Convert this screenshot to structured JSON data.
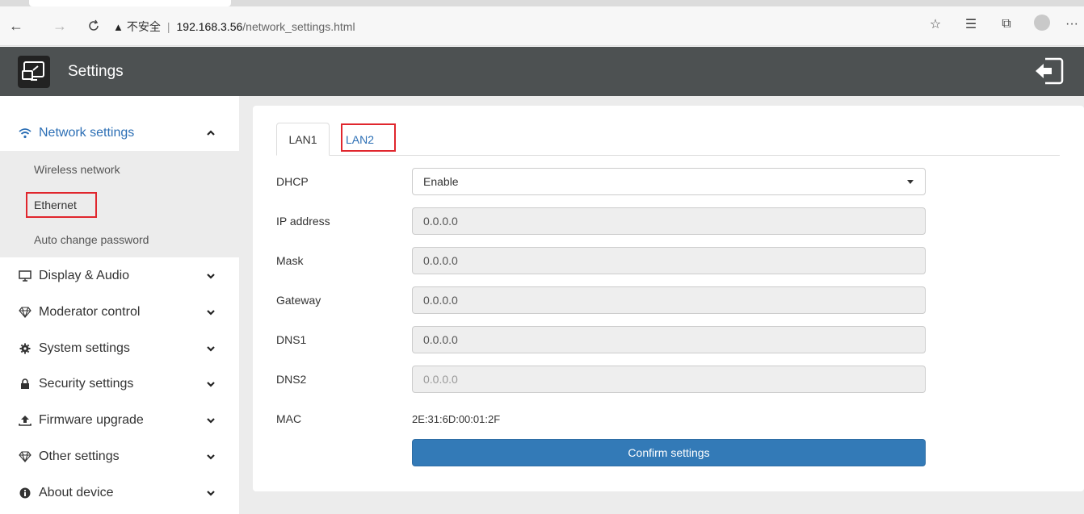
{
  "browser": {
    "insecure_label": "不安全",
    "url_host": "192.168.3.56",
    "url_path": "/network_settings.html",
    "more_label": "···"
  },
  "header": {
    "title": "Settings"
  },
  "sidebar": {
    "items": [
      {
        "label": "Network settings",
        "icon": "wifi-icon",
        "expanded": true
      },
      {
        "label": "Display & Audio",
        "icon": "monitor-icon"
      },
      {
        "label": "Moderator control",
        "icon": "diamond-icon"
      },
      {
        "label": "System settings",
        "icon": "gear-icon"
      },
      {
        "label": "Security settings",
        "icon": "lock-icon"
      },
      {
        "label": "Firmware upgrade",
        "icon": "upload-icon"
      },
      {
        "label": "Other settings",
        "icon": "diamond-icon"
      },
      {
        "label": "About device",
        "icon": "info-icon"
      }
    ],
    "submenu": [
      {
        "label": "Wireless network"
      },
      {
        "label": "Ethernet"
      },
      {
        "label": "Auto change password"
      }
    ]
  },
  "tabs": [
    {
      "label": "LAN1",
      "active": true
    },
    {
      "label": "LAN2",
      "active": false
    }
  ],
  "form": {
    "dhcp_label": "DHCP",
    "dhcp_value": "Enable",
    "ip_label": "IP address",
    "ip_value": "0.0.0.0",
    "mask_label": "Mask",
    "mask_value": "0.0.0.0",
    "gateway_label": "Gateway",
    "gateway_value": "0.0.0.0",
    "dns1_label": "DNS1",
    "dns1_value": "0.0.0.0",
    "dns2_label": "DNS2",
    "dns2_value": "0.0.0.0",
    "mac_label": "MAC",
    "mac_value": "2E:31:6D:00:01:2F",
    "confirm_label": "Confirm settings"
  },
  "colors": {
    "accent": "#2c6fb5",
    "header_bg": "#4d5152",
    "button_bg": "#337ab7",
    "highlight": "#e0262d"
  }
}
